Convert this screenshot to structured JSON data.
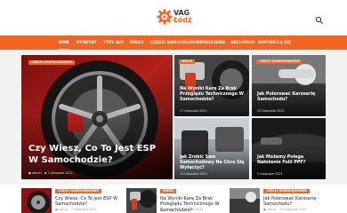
{
  "brand": {
    "line1": "VAG",
    "line2": "Łódź",
    "accent": "#f26522"
  },
  "nav": {
    "items": [
      {
        "label": "DOM"
      },
      {
        "label": "HYBRYDY"
      },
      {
        "label": "TYPY AUT"
      },
      {
        "label": "MIEDŹ"
      },
      {
        "label": "CZĘŚCI SAMOCHODOWE"
      },
      {
        "label": "PODSTAWA"
      },
      {
        "label": "ARCHIWUM"
      },
      {
        "label": "KONTAKTUJ SIĘ"
      }
    ]
  },
  "hero": {
    "badge": "CZĘŚCI SAMOCHODOWE",
    "title": "Czy Wiesz, Co To Jest ESP W Samochodzie?",
    "author": "admin",
    "date": "7 listopada 2022"
  },
  "grid": [
    {
      "badge": "MIEDŹ",
      "title": "Na Wyniki Karę Za Brak Przeglądu Technicznego W Samochodzie?",
      "date": "17 listopada 2022"
    },
    {
      "badge": "CZĘŚCI SAMOCHODOWE",
      "title": "Jak Polerować Karoserię Samochodu?",
      "date": "15 listopada 2022"
    },
    {
      "badge": "",
      "title": "Jak Zrobić Sam Samochodowy Na Chce Się Wyłączyć?",
      "date": "12 listopada 2022"
    },
    {
      "badge": "",
      "title": "Jak Możemy Polega Nałożenie Folii PPF?",
      "date": "5 listopada 2022"
    }
  ],
  "bottom": [
    {
      "badge": "CZĘŚCI SAMOCHODOWE",
      "title": "Czy Wiesz, Co To Jest ESP W Samochodzie?",
      "author": "admin",
      "date": "7 listopada 2022"
    },
    {
      "badge": "MIEDŹ",
      "title": "Na Wyniki Karę Za Brak Przeglądu Technicznego W Samochodzie?",
      "author": "admin",
      "date": "17 listopada 2022"
    },
    {
      "badge": "CZĘŚCI SAMOCHODOWE",
      "title": "Jak Polerować Karoserię Samochodu?",
      "author": "admin",
      "date": "15 listopada 2022"
    }
  ]
}
